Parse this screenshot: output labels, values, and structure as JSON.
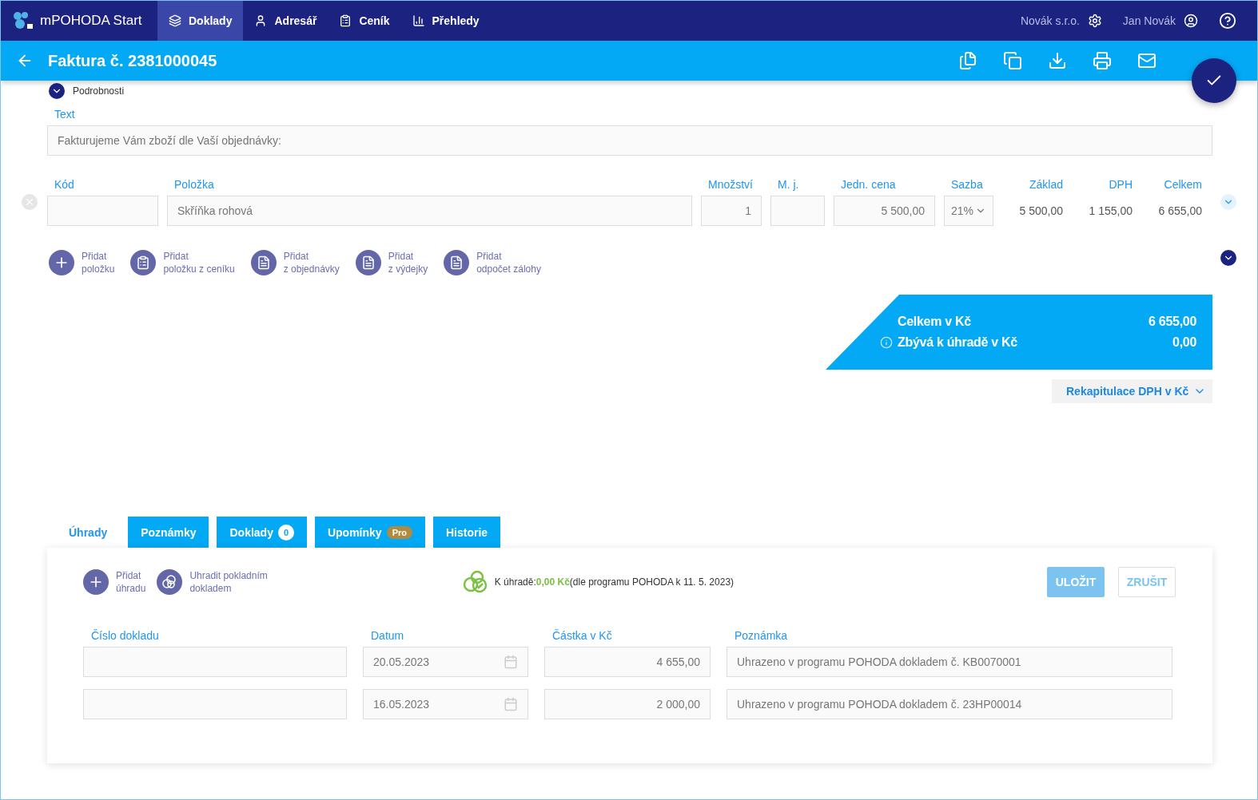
{
  "nav": {
    "brand": "mPOHODA Start",
    "items": [
      {
        "label": "Doklady",
        "selected": true
      },
      {
        "label": "Adresář",
        "selected": false
      },
      {
        "label": "Ceník",
        "selected": false
      },
      {
        "label": "Přehledy",
        "selected": false
      }
    ],
    "company": "Novák s.r.o.",
    "user": "Jan Novák"
  },
  "header": {
    "title": "Faktura č. 2381000045"
  },
  "details": {
    "label": "Podrobnosti"
  },
  "text_field": {
    "label": "Text",
    "placeholder": "Fakturujeme Vám zboží dle Vaší objednávky:"
  },
  "items_table": {
    "columns": [
      "Kód",
      "Položka",
      "Množství",
      "M. j.",
      "Jedn. cena",
      "Sazba",
      "Základ",
      "DPH",
      "Celkem"
    ],
    "rows": [
      {
        "code": "",
        "item": "Skříňka rohová",
        "quantity": "1",
        "unit": "",
        "unit_price": "5 500,00",
        "rate": "21%",
        "base": "5 500,00",
        "vat": "1 155,00",
        "total": "6 655,00"
      }
    ]
  },
  "add_actions": [
    {
      "kind": "plus",
      "lines": [
        "Přidat",
        "položku"
      ]
    },
    {
      "kind": "clipboard",
      "lines": [
        "Přidat",
        "položku z ceníku"
      ]
    },
    {
      "kind": "document",
      "lines": [
        "Přidat",
        "z objednávky"
      ]
    },
    {
      "kind": "document",
      "lines": [
        "Přidat",
        "z výdejky"
      ]
    },
    {
      "kind": "document",
      "lines": [
        "Přidat",
        "odpočet zálohy"
      ]
    }
  ],
  "totals": [
    {
      "label": "Celkem v Kč",
      "value": "6 655,00",
      "info": false
    },
    {
      "label": "Zbývá k úhradě v Kč",
      "value": "0,00",
      "info": true
    }
  ],
  "vat_recap": {
    "label": "Rekapitulace DPH v Kč"
  },
  "tabs": [
    {
      "label": "Úhrady",
      "selected": true,
      "kind": "plain"
    },
    {
      "label": "Poznámky",
      "selected": false,
      "kind": "plain"
    },
    {
      "label": "Doklady",
      "selected": false,
      "badge": "0",
      "kind": "count"
    },
    {
      "label": "Upomínky",
      "selected": false,
      "badge": "Pro",
      "kind": "pro"
    },
    {
      "label": "Historie",
      "selected": false,
      "kind": "plain"
    }
  ],
  "payments": {
    "actions": [
      {
        "kind": "plus",
        "lines": [
          "Přidat",
          "úhradu"
        ]
      },
      {
        "kind": "rings",
        "lines": [
          "Uhradit pokladním",
          "dokladem"
        ]
      }
    ],
    "status": {
      "prefix": "K úhradě:",
      "amount": "0,00 Kč",
      "note": "(dle programu POHODA k 11. 5. 2023)"
    },
    "buttons": [
      {
        "label": "ULOŽIT",
        "kind": "primary"
      },
      {
        "label": "ZRUŠIT",
        "kind": "secondary"
      }
    ],
    "columns": [
      "Číslo dokladu",
      "Datum",
      "Částka v Kč",
      "Poznámka"
    ],
    "rows": [
      {
        "number": "",
        "date": "20.05.2023",
        "amount": "4 655,00",
        "note": "Uhrazeno v programu POHODA dokladem č. KB0070001"
      },
      {
        "number": "",
        "date": "16.05.2023",
        "amount": "2 000,00",
        "note": "Uhrazeno v programu POHODA dokladem č. 23HP00014"
      }
    ]
  }
}
